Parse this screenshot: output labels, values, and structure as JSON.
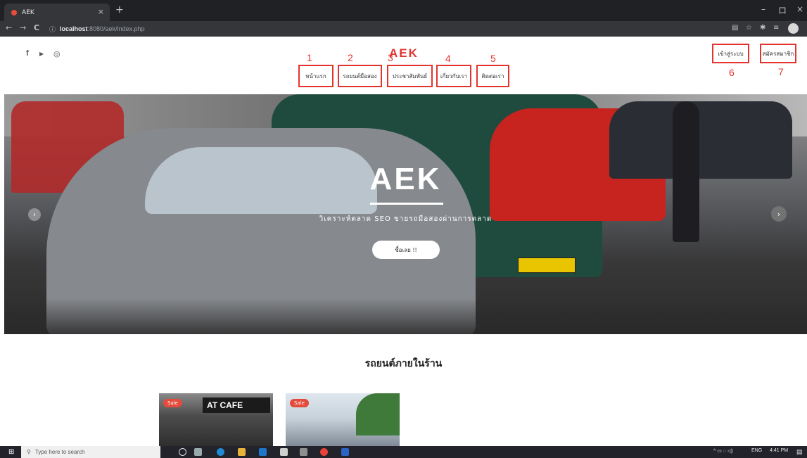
{
  "browser": {
    "tab_title": "AEK",
    "tab_close": "×",
    "new_tab": "+",
    "win_min": "–",
    "win_max": "ロ",
    "win_close": "×",
    "back": "←",
    "forward": "→",
    "reload": "C",
    "url_host": "localhost",
    "url_path": ":8080/aek/index.php"
  },
  "header": {
    "brand": "AEK",
    "social": [
      "f",
      "▶",
      "◎"
    ],
    "nav": [
      {
        "label": "หน้าแรก",
        "marker": "1"
      },
      {
        "label": "รถยนต์มือสอง",
        "marker": "2"
      },
      {
        "label": "ประชาสัมพันธ์",
        "marker": "3"
      },
      {
        "label": "เกี่ยวกับเรา",
        "marker": "4"
      },
      {
        "label": "ติดต่อเรา",
        "marker": "5"
      }
    ],
    "login": {
      "label": "เข้าสู่ระบบ",
      "marker": "6"
    },
    "register": {
      "label": "สมัครสมาชิก",
      "marker": "7"
    }
  },
  "hero": {
    "title": "AEK",
    "subtitle": "วิเคราะห์ตลาด SEO ขายรถมือสองผ่านการตลาด",
    "button": "ซื้อเลย !!",
    "prev": "‹",
    "next": "›"
  },
  "section": {
    "title": "รถยนต์ภายในร้าน"
  },
  "cards": [
    {
      "badge": "Sale",
      "sign": "AT CAFE"
    },
    {
      "badge": "Sale"
    }
  ],
  "taskbar": {
    "search_placeholder": "Type here to search",
    "lang": "ENG",
    "time": "4:41 PM"
  }
}
